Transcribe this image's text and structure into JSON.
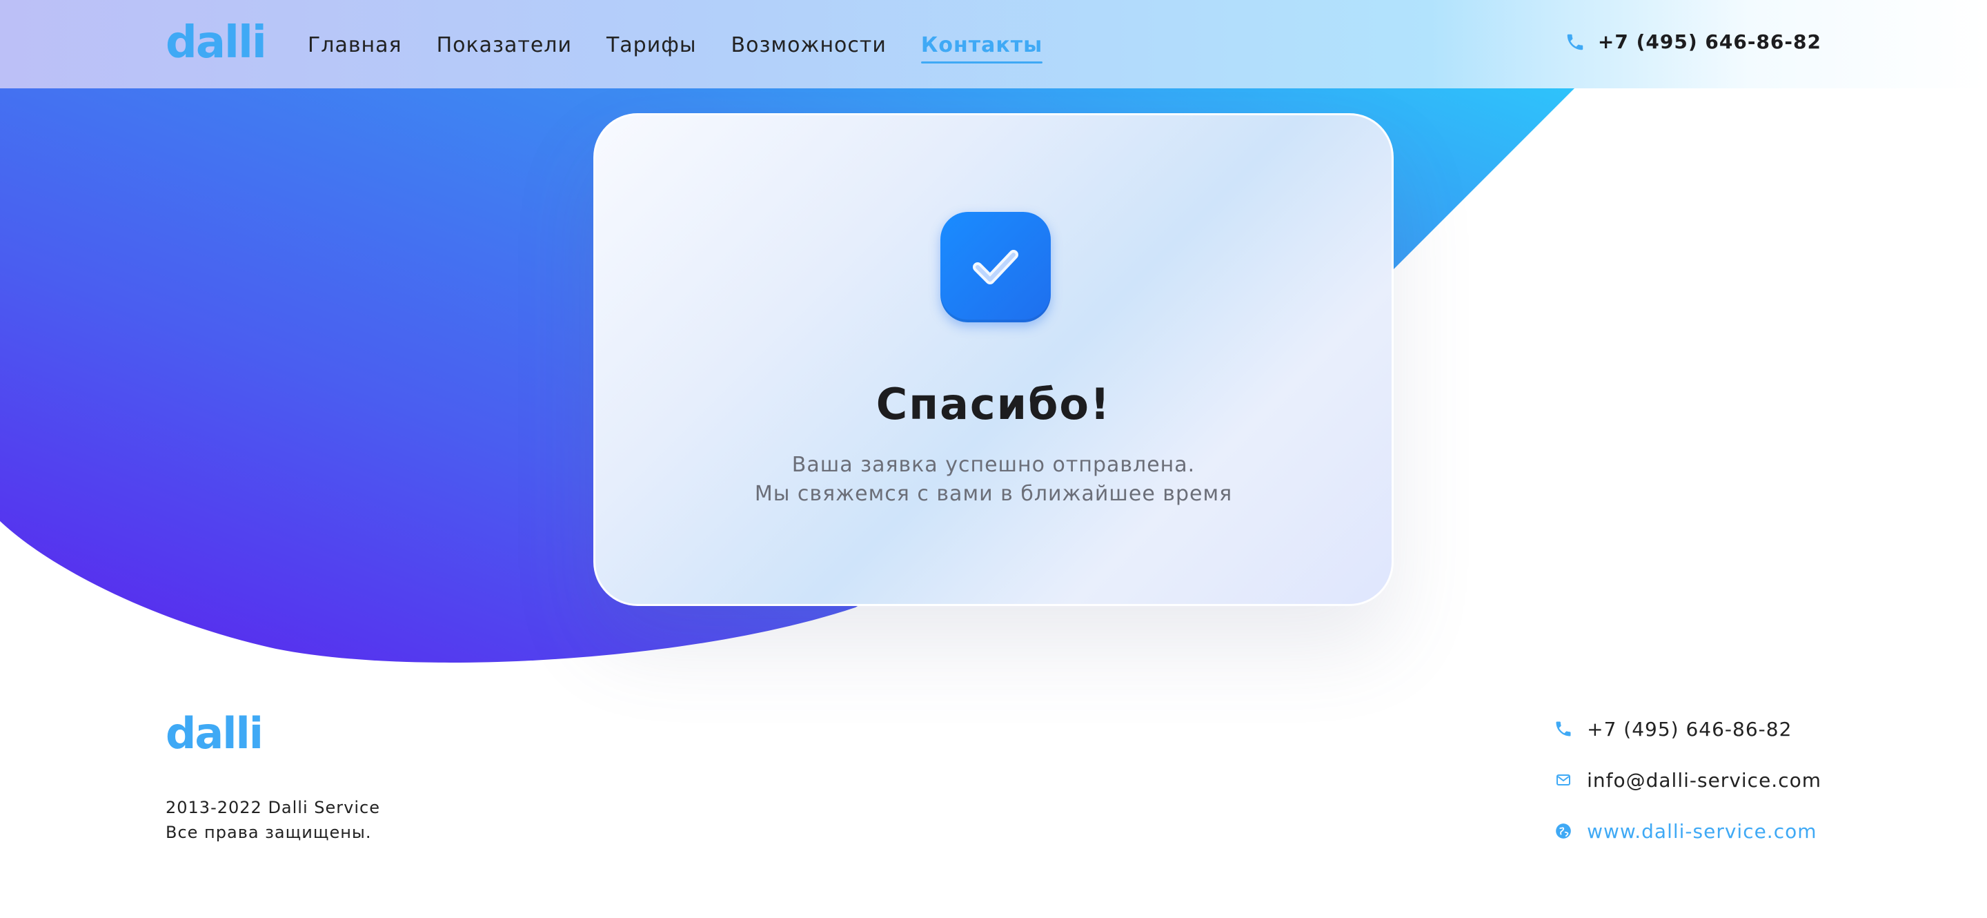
{
  "brand": {
    "logo_text": "dalli",
    "accent_color": "#3fa9f5"
  },
  "header": {
    "nav": [
      {
        "label": "Главная"
      },
      {
        "label": "Показатели"
      },
      {
        "label": "Тарифы"
      },
      {
        "label": "Возможности"
      },
      {
        "label": "Контакты",
        "active": true
      }
    ],
    "phone": "+7 (495) 646-86-82",
    "phone_icon": "phone-icon"
  },
  "card": {
    "icon": "checkmark-icon",
    "title": "Спасибо!",
    "line1": "Ваша заявка успешно отправлена.",
    "line2": "Мы свяжемся с вами в ближайшее время"
  },
  "footer": {
    "logo_text": "dalli",
    "copyright_line1": "2013-2022 Dalli Service",
    "copyright_line2": "Все права защищены.",
    "contacts": {
      "phone": "+7 (495) 646-86-82",
      "email": "info@dalli-service.com",
      "website": "www.dalli-service.com"
    }
  },
  "colors": {
    "gradient_purple": "#5b2df0",
    "gradient_blue": "#4a6cf0",
    "gradient_cyan": "#2ec0fa",
    "check_badge": "#1a8cff"
  }
}
